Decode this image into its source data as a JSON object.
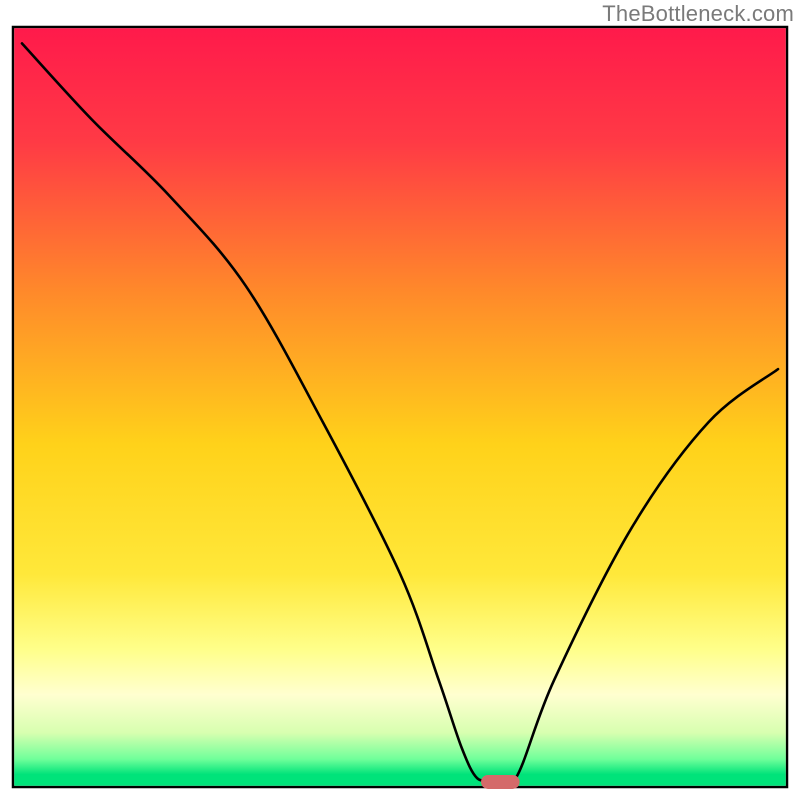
{
  "watermark": "TheBottleneck.com",
  "chart_data": {
    "type": "line",
    "title": "",
    "xlabel": "",
    "ylabel": "",
    "xlim": [
      0,
      100
    ],
    "ylim": [
      0,
      100
    ],
    "axes_visible": false,
    "grid": false,
    "background_gradient": {
      "stops": [
        {
          "offset": 0.0,
          "color": "#ff1a4b"
        },
        {
          "offset": 0.15,
          "color": "#ff3a45"
        },
        {
          "offset": 0.35,
          "color": "#ff8a2a"
        },
        {
          "offset": 0.55,
          "color": "#ffd21a"
        },
        {
          "offset": 0.72,
          "color": "#ffe83a"
        },
        {
          "offset": 0.82,
          "color": "#ffff8a"
        },
        {
          "offset": 0.88,
          "color": "#ffffd0"
        },
        {
          "offset": 0.93,
          "color": "#d8ffb0"
        },
        {
          "offset": 0.965,
          "color": "#6fff9a"
        },
        {
          "offset": 0.985,
          "color": "#00e37a"
        },
        {
          "offset": 1.0,
          "color": "#00e37a"
        }
      ]
    },
    "series": [
      {
        "name": "bottleneck-curve",
        "color": "#000000",
        "x": [
          1,
          10,
          20,
          30,
          40,
          50,
          55,
          58,
          60,
          62,
          65,
          70,
          80,
          90,
          99
        ],
        "values": [
          98,
          88,
          78,
          66,
          48,
          28,
          14,
          5,
          1,
          1,
          1,
          14,
          34,
          48,
          55
        ]
      }
    ],
    "marker": {
      "name": "optimal-range",
      "x_center": 63,
      "y": 0.5,
      "width": 5,
      "color": "#d46a6a"
    }
  }
}
